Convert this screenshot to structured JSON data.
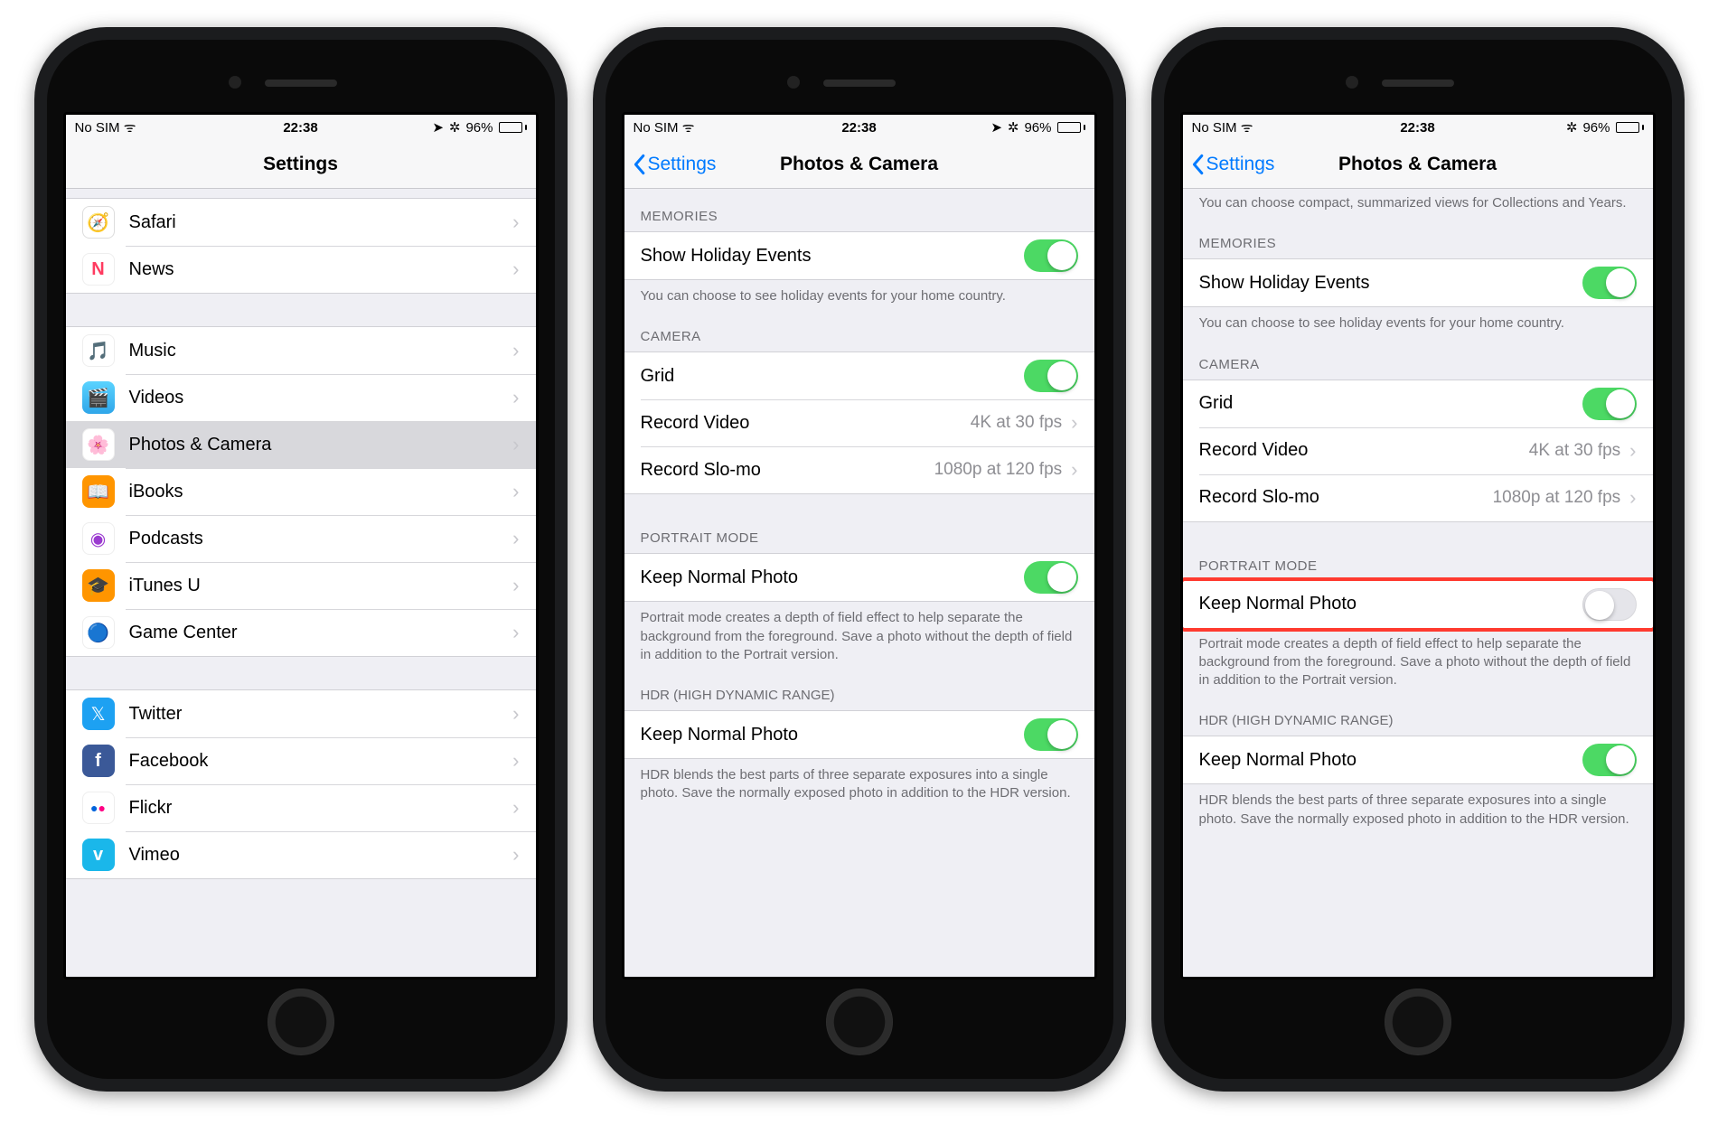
{
  "status": {
    "carrier": "No SIM",
    "wifi": "ᯤ",
    "time": "22:38",
    "location_glyph": "➤",
    "bt_glyph": "⁕",
    "battery_pct": "96%"
  },
  "phone1": {
    "title": "Settings",
    "groups": [
      {
        "items": [
          {
            "icon_bg": "#ffffff",
            "icon_text": "🧭",
            "label": "Safari"
          },
          {
            "icon_bg": "#ffffff",
            "icon_text": "🅽",
            "label": "News"
          }
        ]
      },
      {
        "items": [
          {
            "icon_bg": "#ffffff",
            "icon_text": "🎵",
            "label": "Music"
          },
          {
            "icon_bg": "#34c8ff",
            "icon_text": "🎬",
            "label": "Videos"
          },
          {
            "icon_bg": "#ffffff",
            "icon_text": "🌸",
            "label": "Photos & Camera",
            "selected": true
          },
          {
            "icon_bg": "#ff9500",
            "icon_text": "📖",
            "label": "iBooks"
          },
          {
            "icon_bg": "#ffffff",
            "icon_text": "🟣",
            "label": "Podcasts"
          },
          {
            "icon_bg": "#ff9500",
            "icon_text": "🎓",
            "label": "iTunes U"
          },
          {
            "icon_bg": "#ffffff",
            "icon_text": "🟡",
            "label": "Game Center"
          }
        ]
      },
      {
        "items": [
          {
            "icon_bg": "#1da1f2",
            "icon_text": "t",
            "label": "Twitter"
          },
          {
            "icon_bg": "#3b5998",
            "icon_text": "f",
            "label": "Facebook"
          },
          {
            "icon_bg": "#ffffff",
            "icon_text": "••",
            "label": "Flickr"
          },
          {
            "icon_bg": "#1ab7ea",
            "icon_text": "v",
            "label": "Vimeo"
          }
        ]
      }
    ]
  },
  "phone2": {
    "back_label": "Settings",
    "title": "Photos & Camera",
    "memories_header": "MEMORIES",
    "memories_item": "Show Holiday Events",
    "memories_footer": "You can choose to see holiday events for your home country.",
    "camera_header": "CAMERA",
    "camera_items": {
      "grid": "Grid",
      "record_video": {
        "label": "Record Video",
        "detail": "4K at 30 fps"
      },
      "record_slomo": {
        "label": "Record Slo-mo",
        "detail": "1080p at 120 fps"
      }
    },
    "portrait_header": "PORTRAIT MODE",
    "portrait_item": "Keep Normal Photo",
    "portrait_footer": "Portrait mode creates a depth of field effect to help separate the background from the foreground. Save a photo without the depth of field in addition to the Portrait version.",
    "hdr_header": "HDR (HIGH DYNAMIC RANGE)",
    "hdr_item": "Keep Normal Photo",
    "hdr_footer": "HDR blends the best parts of three separate exposures into a single photo. Save the normally exposed photo in addition to the HDR version."
  },
  "phone3": {
    "back_label": "Settings",
    "title": "Photos & Camera",
    "top_note": "You can choose compact, summarized views for Collections and Years.",
    "memories_header": "MEMORIES",
    "memories_item": "Show Holiday Events",
    "memories_footer": "You can choose to see holiday events for your home country.",
    "camera_header": "CAMERA",
    "camera_items": {
      "grid": "Grid",
      "record_video": {
        "label": "Record Video",
        "detail": "4K at 30 fps"
      },
      "record_slomo": {
        "label": "Record Slo-mo",
        "detail": "1080p at 120 fps"
      }
    },
    "portrait_header": "PORTRAIT MODE",
    "portrait_item": "Keep Normal Photo",
    "portrait_footer": "Portrait mode creates a depth of field effect to help separate the background from the foreground. Save a photo without the depth of field in addition to the Portrait version.",
    "hdr_header": "HDR (HIGH DYNAMIC RANGE)",
    "hdr_item": "Keep Normal Photo",
    "hdr_footer": "HDR blends the best parts of three separate exposures into a single photo. Save the normally exposed photo in addition to the HDR version."
  }
}
